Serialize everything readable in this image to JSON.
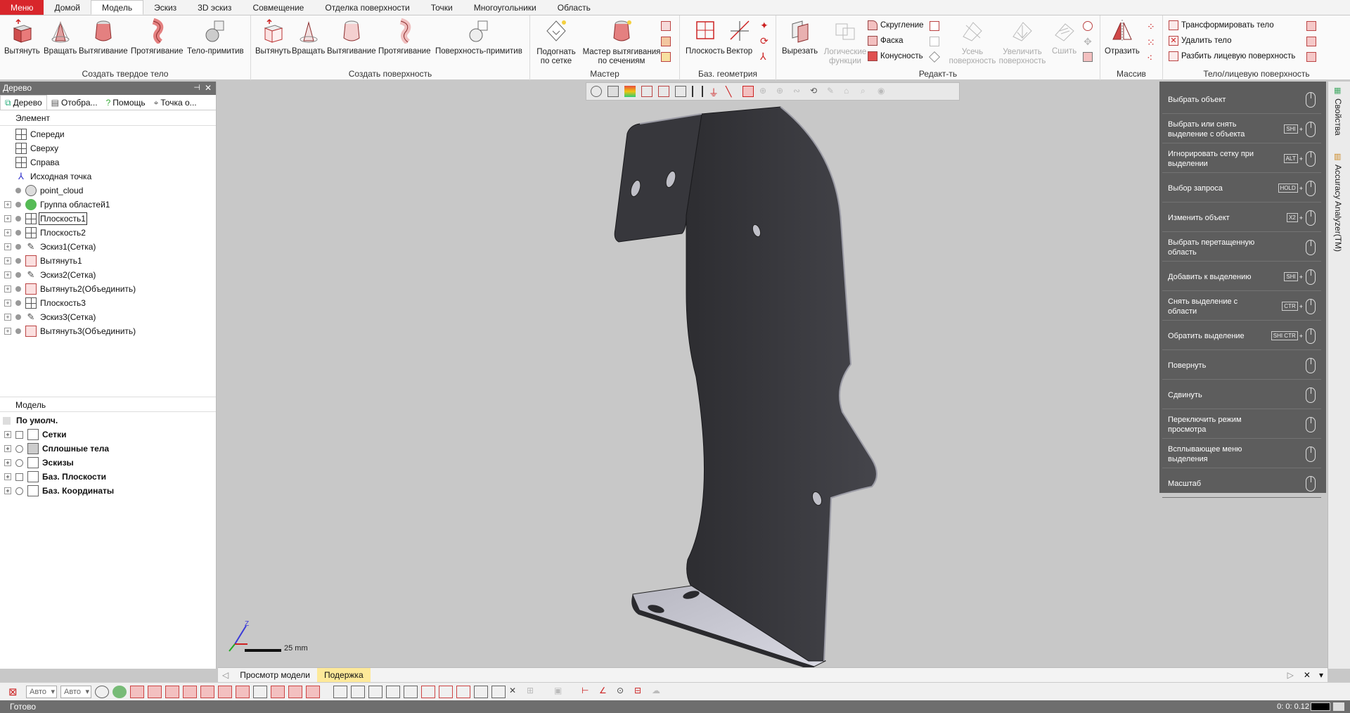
{
  "tabs": [
    "Меню",
    "Домой",
    "Модель",
    "Эскиз",
    "3D эскиз",
    "Совмещение",
    "Отделка поверхности",
    "Точки",
    "Многоугольники",
    "Область"
  ],
  "active_tab": "Модель",
  "ribbon": {
    "solid": {
      "label": "Создать твердое тело",
      "buttons": [
        "Вытянуть",
        "Вращать",
        "Вытягивание",
        "Протягивание",
        "Тело-примитив"
      ]
    },
    "surface": {
      "label": "Создать поверхность",
      "buttons": [
        "Вытянуть",
        "Вращать",
        "Вытягивание",
        "Протягивание",
        "Поверхность-примитив"
      ]
    },
    "wizard": {
      "label": "Мастер",
      "buttons": [
        "Подогнать по сетке",
        "Мастер вытягивания по сечениям"
      ]
    },
    "refgeom": {
      "label": "Баз. геометрия",
      "buttons": [
        "Плоскость",
        "Вектор"
      ]
    },
    "edit": {
      "label": "Редакт-ть",
      "buttons": [
        "Вырезать",
        "Логические функции",
        "Усечь поверхность",
        "Увеличить поверхность",
        "Сшить"
      ],
      "small": [
        "Скругление",
        "Фаска",
        "Конусность"
      ]
    },
    "array": {
      "label": "Массив",
      "buttons": [
        "Отразить"
      ]
    },
    "body": {
      "label": "Тело/лицевую поверхность",
      "small": [
        "Трансформировать тело",
        "Удалить тело",
        "Разбить лицевую поверхность"
      ]
    }
  },
  "tree": {
    "title": "Дерево",
    "tabs": [
      "Дерево",
      "Отобра...",
      "Помощь",
      "Точка о..."
    ],
    "header": "Элемент",
    "items": [
      {
        "label": "Спереди",
        "icon": "plane-icon"
      },
      {
        "label": "Сверху",
        "icon": "plane-icon"
      },
      {
        "label": "Справа",
        "icon": "plane-icon"
      },
      {
        "label": "Исходная точка",
        "icon": "origin-icon"
      },
      {
        "label": "point_cloud",
        "icon": "cloud-icon"
      },
      {
        "label": "Группа областей1",
        "icon": "region-group-icon"
      },
      {
        "label": "Плоскость1",
        "icon": "plane-icon"
      },
      {
        "label": "Плоскость2",
        "icon": "plane-icon"
      },
      {
        "label": "Эскиз1(Сетка)",
        "icon": "sketch-icon"
      },
      {
        "label": "Вытянуть1",
        "icon": "extrude-icon"
      },
      {
        "label": "Эскиз2(Сетка)",
        "icon": "sketch-icon"
      },
      {
        "label": "Вытянуть2(Объединить)",
        "icon": "extrude-icon"
      },
      {
        "label": "Плоскость3",
        "icon": "plane-icon"
      },
      {
        "label": "Эскиз3(Сетка)",
        "icon": "sketch-icon"
      },
      {
        "label": "Вытянуть3(Объединить)",
        "icon": "extrude-icon"
      }
    ],
    "model_header": "Модель",
    "model_root": "По умолч.",
    "model_items": [
      "Сетки",
      "Сплошные тела",
      "Эскизы",
      "Баз. Плоскости",
      "Баз. Координаты"
    ]
  },
  "mouse_panel": [
    {
      "label": "Выбрать объект",
      "key": ""
    },
    {
      "label": "Выбрать или снять выделение с объекта",
      "key": "SHI"
    },
    {
      "label": "Игнорировать сетку при выделении",
      "key": "ALT"
    },
    {
      "label": "Выбор запроса",
      "key": "HOLD"
    },
    {
      "label": "Изменить объект",
      "key": "X2"
    },
    {
      "label": "Выбрать перетащенную область",
      "key": ""
    },
    {
      "label": "Добавить к выделению",
      "key": "SHI"
    },
    {
      "label": "Снять выделение с области",
      "key": "CTR"
    },
    {
      "label": "Обратить выделение",
      "key": "SHI CTR"
    },
    {
      "label": "Повернуть",
      "key": ""
    },
    {
      "label": "Сдвинуть",
      "key": ""
    },
    {
      "label": "Переключить режим просмотра",
      "key": ""
    },
    {
      "label": "Всплывающее меню выделения",
      "key": ""
    },
    {
      "label": "Масштаб",
      "key": ""
    }
  ],
  "side_tabs": [
    "Свойства",
    "Accuracy Analyzer(TM)"
  ],
  "doc_tabs": [
    "Просмотр модели",
    "Подержка"
  ],
  "combos": [
    "Авто",
    "Авто"
  ],
  "scale_label": "25 mm",
  "status": "Готово",
  "status_right": "0: 0: 0.12",
  "colors": {
    "menu": "#d8262b",
    "part": "#3a3a3e",
    "panel": "#5d5d5d"
  }
}
